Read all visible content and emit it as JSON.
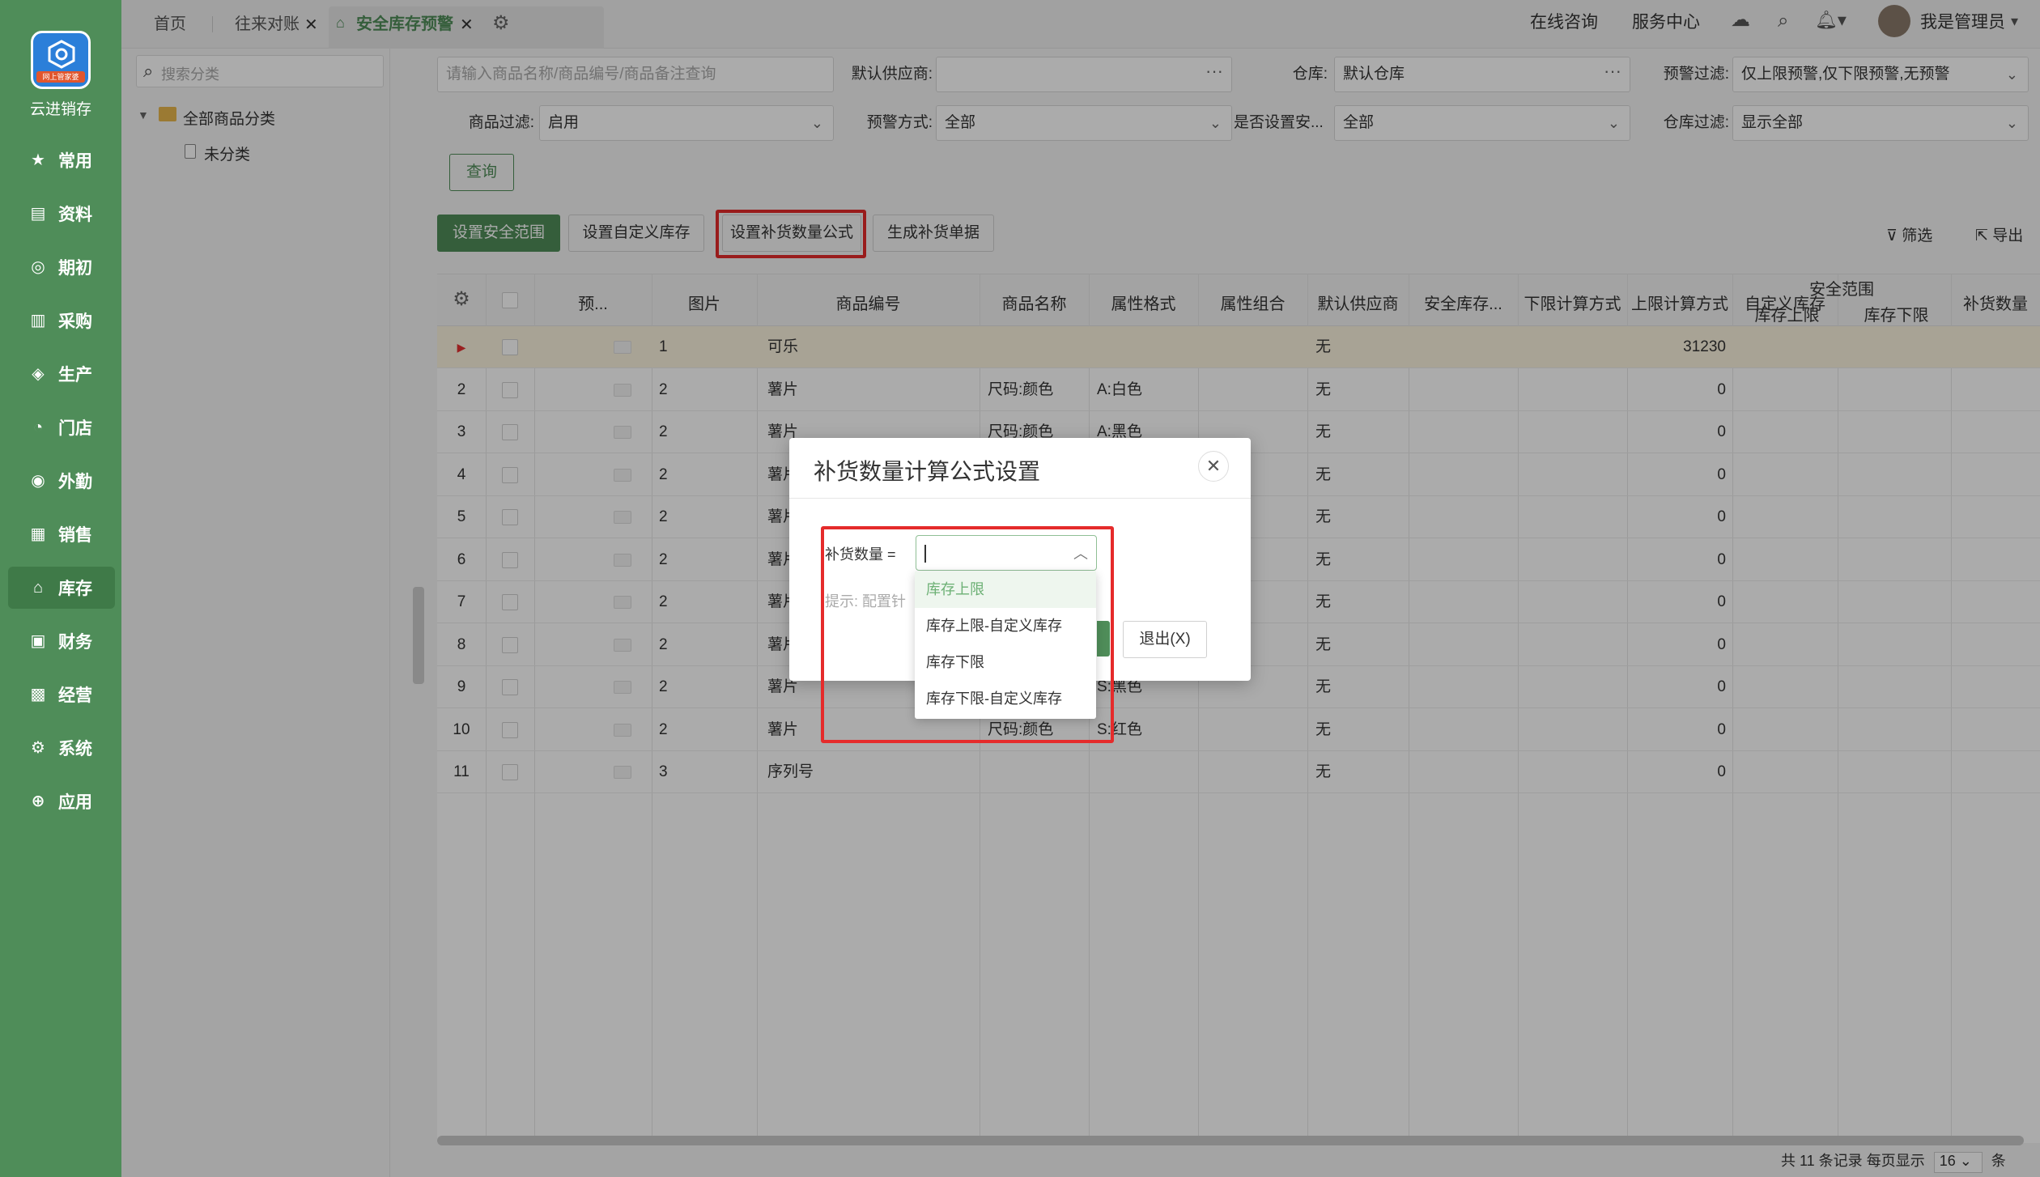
{
  "sidebar": {
    "brand": "云进销存",
    "logo_tag": "网上管家婆",
    "items": [
      {
        "label": "常用",
        "icon": "star-icon"
      },
      {
        "label": "资料",
        "icon": "data-icon"
      },
      {
        "label": "期初",
        "icon": "target-icon"
      },
      {
        "label": "采购",
        "icon": "purchase-icon"
      },
      {
        "label": "生产",
        "icon": "production-icon"
      },
      {
        "label": "门店",
        "icon": "store-icon"
      },
      {
        "label": "外勤",
        "icon": "field-icon"
      },
      {
        "label": "销售",
        "icon": "sales-icon"
      },
      {
        "label": "库存",
        "icon": "warehouse-icon"
      },
      {
        "label": "财务",
        "icon": "finance-icon"
      },
      {
        "label": "经营",
        "icon": "business-icon"
      },
      {
        "label": "系统",
        "icon": "system-icon"
      },
      {
        "label": "应用",
        "icon": "app-icon"
      }
    ]
  },
  "tabs": {
    "home": "首页",
    "t2": "往来对账",
    "t3": "安全库存预警"
  },
  "topright": {
    "consult": "在线咨询",
    "service": "服务中心",
    "user": "我是管理员"
  },
  "tree": {
    "search_placeholder": "搜索分类",
    "root": "全部商品分类",
    "child": "未分类"
  },
  "filters": {
    "search_placeholder": "请输入商品名称/商品编号/商品备注查询",
    "supplier_label": "默认供应商:",
    "supplier_value": "",
    "warehouse_label": "仓库:",
    "warehouse_value": "默认仓库",
    "warn_filter_label": "预警过滤:",
    "warn_filter_value": "仅上限预警,仅下限预警,无预警",
    "goods_filter_label": "商品过滤:",
    "goods_filter_value": "启用",
    "warn_mode_label": "预警方式:",
    "warn_mode_value": "全部",
    "safety_set_label": "是否设置安...",
    "safety_set_value": "全部",
    "wh_filter_label": "仓库过滤:",
    "wh_filter_value": "显示全部",
    "query": "查询"
  },
  "toolbar": {
    "b1": "设置安全范围",
    "b2": "设置自定义库存",
    "b3": "设置补货数量公式",
    "b4": "生成补货单据",
    "filter": "筛选",
    "export": "导出"
  },
  "table": {
    "headers": [
      "预...",
      "图片",
      "商品编号",
      "商品名称",
      "属性格式",
      "属性组合",
      "默认供应商",
      "安全库存...",
      "下限计算方式",
      "上限计算方式",
      "自定义库存",
      "安全范围",
      "库存上限",
      "库存下限",
      "补货数量"
    ],
    "rows": [
      {
        "n": "1",
        "code": "1",
        "name": "可乐",
        "fmt": "",
        "combo": "",
        "safe": "无",
        "custom": "31230"
      },
      {
        "n": "2",
        "code": "2",
        "name": "薯片",
        "fmt": "尺码:颜色",
        "combo": "A:白色",
        "safe": "无",
        "custom": "0"
      },
      {
        "n": "3",
        "code": "2",
        "name": "薯片",
        "fmt": "尺码:颜色",
        "combo": "A:黑色",
        "safe": "无",
        "custom": "0"
      },
      {
        "n": "4",
        "code": "2",
        "name": "薯片",
        "fmt": "",
        "combo": "",
        "safe": "无",
        "custom": "0"
      },
      {
        "n": "5",
        "code": "2",
        "name": "薯片",
        "fmt": "",
        "combo": "",
        "safe": "无",
        "custom": "0"
      },
      {
        "n": "6",
        "code": "2",
        "name": "薯片",
        "fmt": "",
        "combo": "",
        "safe": "无",
        "custom": "0"
      },
      {
        "n": "7",
        "code": "2",
        "name": "薯片",
        "fmt": "",
        "combo": "",
        "safe": "无",
        "custom": "0"
      },
      {
        "n": "8",
        "code": "2",
        "name": "薯片",
        "fmt": "",
        "combo": "",
        "safe": "无",
        "custom": "0"
      },
      {
        "n": "9",
        "code": "2",
        "name": "薯片",
        "fmt": "",
        "combo": "S:黑色",
        "safe": "无",
        "custom": "0"
      },
      {
        "n": "10",
        "code": "2",
        "name": "薯片",
        "fmt": "尺码:颜色",
        "combo": "S:红色",
        "safe": "无",
        "custom": "0"
      },
      {
        "n": "11",
        "code": "3",
        "name": "序列号",
        "fmt": "",
        "combo": "",
        "safe": "无",
        "custom": "0"
      }
    ]
  },
  "footer": {
    "total": "共 11 条记录  每页显示",
    "per_page": "16",
    "unit": "条"
  },
  "dialog": {
    "title": "补货数量计算公式设置",
    "label": "补货数量 =",
    "tip": "提示: 配置针",
    "exit": "退出(X)",
    "options": [
      "库存上限",
      "库存上限-自定义库存",
      "库存下限",
      "库存下限-自定义库存"
    ]
  },
  "colors": {
    "sidebar": "#4f8d59",
    "highlight": "#e52b2b",
    "selected_row": "#fbf3de"
  }
}
